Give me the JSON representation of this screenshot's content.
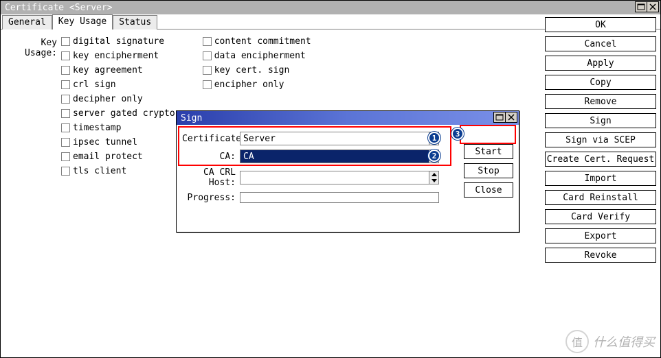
{
  "window": {
    "title": "Certificate <Server>"
  },
  "tabs": {
    "general": "General",
    "key_usage": "Key Usage",
    "status": "Status"
  },
  "key_usage": {
    "label": "Key Usage:",
    "col1": [
      "digital signature",
      "key encipherment",
      "key agreement",
      "crl sign",
      "decipher only",
      "server gated crypto",
      "timestamp",
      "ipsec tunnel",
      "email protect",
      "tls client"
    ],
    "col2": [
      "content commitment",
      "data encipherment",
      "key cert. sign",
      "encipher only"
    ]
  },
  "right_buttons": {
    "ok": "OK",
    "cancel": "Cancel",
    "apply": "Apply",
    "copy": "Copy",
    "remove": "Remove",
    "sign": "Sign",
    "sign_scep": "Sign via SCEP",
    "create_req": "Create Cert. Request",
    "import": "Import",
    "card_reinstall": "Card Reinstall",
    "card_verify": "Card Verify",
    "export": "Export",
    "revoke": "Revoke"
  },
  "sign_dialog": {
    "title": "Sign",
    "certificate_label": "Certificate:",
    "certificate_value": "Server",
    "ca_label": "CA:",
    "ca_value": "CA",
    "crl_label": "CA CRL Host:",
    "crl_value": "",
    "progress_label": "Progress:",
    "buttons": {
      "start": "Start",
      "stop": "Stop",
      "close": "Close"
    }
  },
  "annotations": {
    "b1": "1",
    "b2": "2",
    "b3": "3"
  },
  "watermark": {
    "icon": "值",
    "text": "什么值得买"
  }
}
